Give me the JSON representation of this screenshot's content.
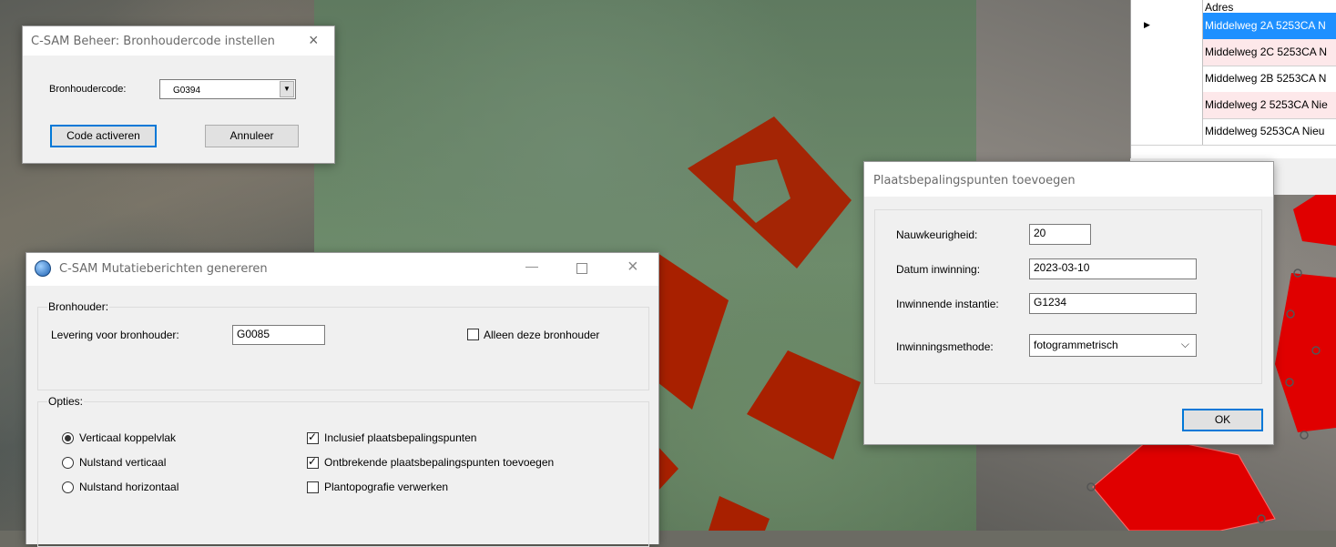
{
  "dlg_code": {
    "title": "C-SAM Beheer: Bronhoudercode instellen",
    "field_label": "Bronhoudercode:",
    "selected_code": "G0394",
    "activate_label": "Code activeren",
    "cancel_label": "Annuleer"
  },
  "dlg_mutatie": {
    "title": "C-SAM Mutatieberichten genereren",
    "group_bronhouder": "Bronhouder:",
    "levering_label": "Levering voor bronhouder:",
    "levering_value": "G0085",
    "alleen_label": "Alleen deze bronhouder",
    "alleen_checked": false,
    "group_opties": "Opties:",
    "radios": [
      {
        "label": "Verticaal koppelvlak",
        "checked": true
      },
      {
        "label": "Nulstand verticaal",
        "checked": false
      },
      {
        "label": "Nulstand horizontaal",
        "checked": false
      }
    ],
    "checks": [
      {
        "label": "Inclusief plaatsbepalingspunten",
        "checked": true
      },
      {
        "label": "Ontbrekende plaatsbepalingspunten toevoegen",
        "checked": true
      },
      {
        "label": "Plantopografie verwerken",
        "checked": false
      }
    ]
  },
  "dlg_plaats": {
    "title": "Plaatsbepalingspunten toevoegen",
    "nauwkeurigheid_label": "Nauwkeurigheid:",
    "nauwkeurigheid_value": "20",
    "datum_label": "Datum inwinning:",
    "datum_value": "2023-03-10",
    "instantie_label": "Inwinnende instantie:",
    "instantie_value": "G1234",
    "methode_label": "Inwinningsmethode:",
    "methode_value": "fotogrammetrisch",
    "ok_label": "OK"
  },
  "address_grid": {
    "header": "Adres",
    "rows": [
      "Middelweg 2A 5253CA N",
      "Middelweg 2C 5253CA N",
      "Middelweg 2B 5253CA N",
      "Middelweg 2 5253CA Nie",
      "Middelweg 5253CA Nieu"
    ]
  },
  "colors": {
    "parcel_red": "#a82000",
    "parcel_bright": "#e00000",
    "selection_blue": "#1e90ff",
    "row_pink": "#fde8ea",
    "row_selected": "#cce4f7"
  }
}
